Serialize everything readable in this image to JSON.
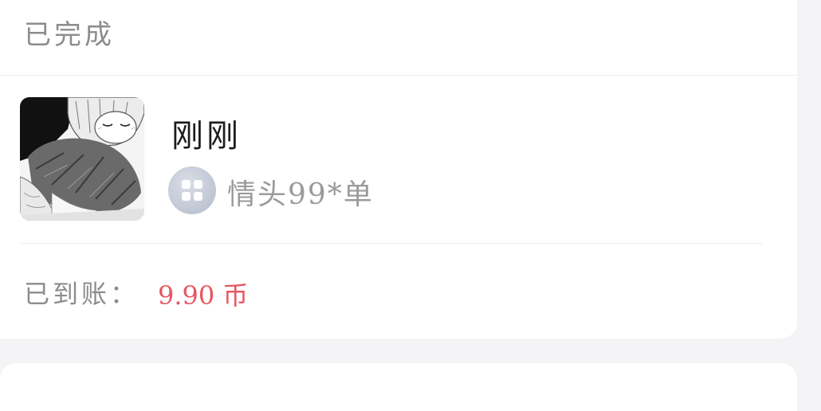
{
  "order": {
    "status": "已完成",
    "user_name": "刚刚",
    "tag_text": "情头99*单",
    "amount_label": "已到账：",
    "amount_value": "9.90 币"
  },
  "icons": {
    "cover": "anime-avatar-image",
    "tag": "grid-apps-icon"
  },
  "colors": {
    "page_bg": "#f4f4f6",
    "card_bg": "#ffffff",
    "amount_red": "#e8555f",
    "muted_text": "#8c8c8c"
  }
}
